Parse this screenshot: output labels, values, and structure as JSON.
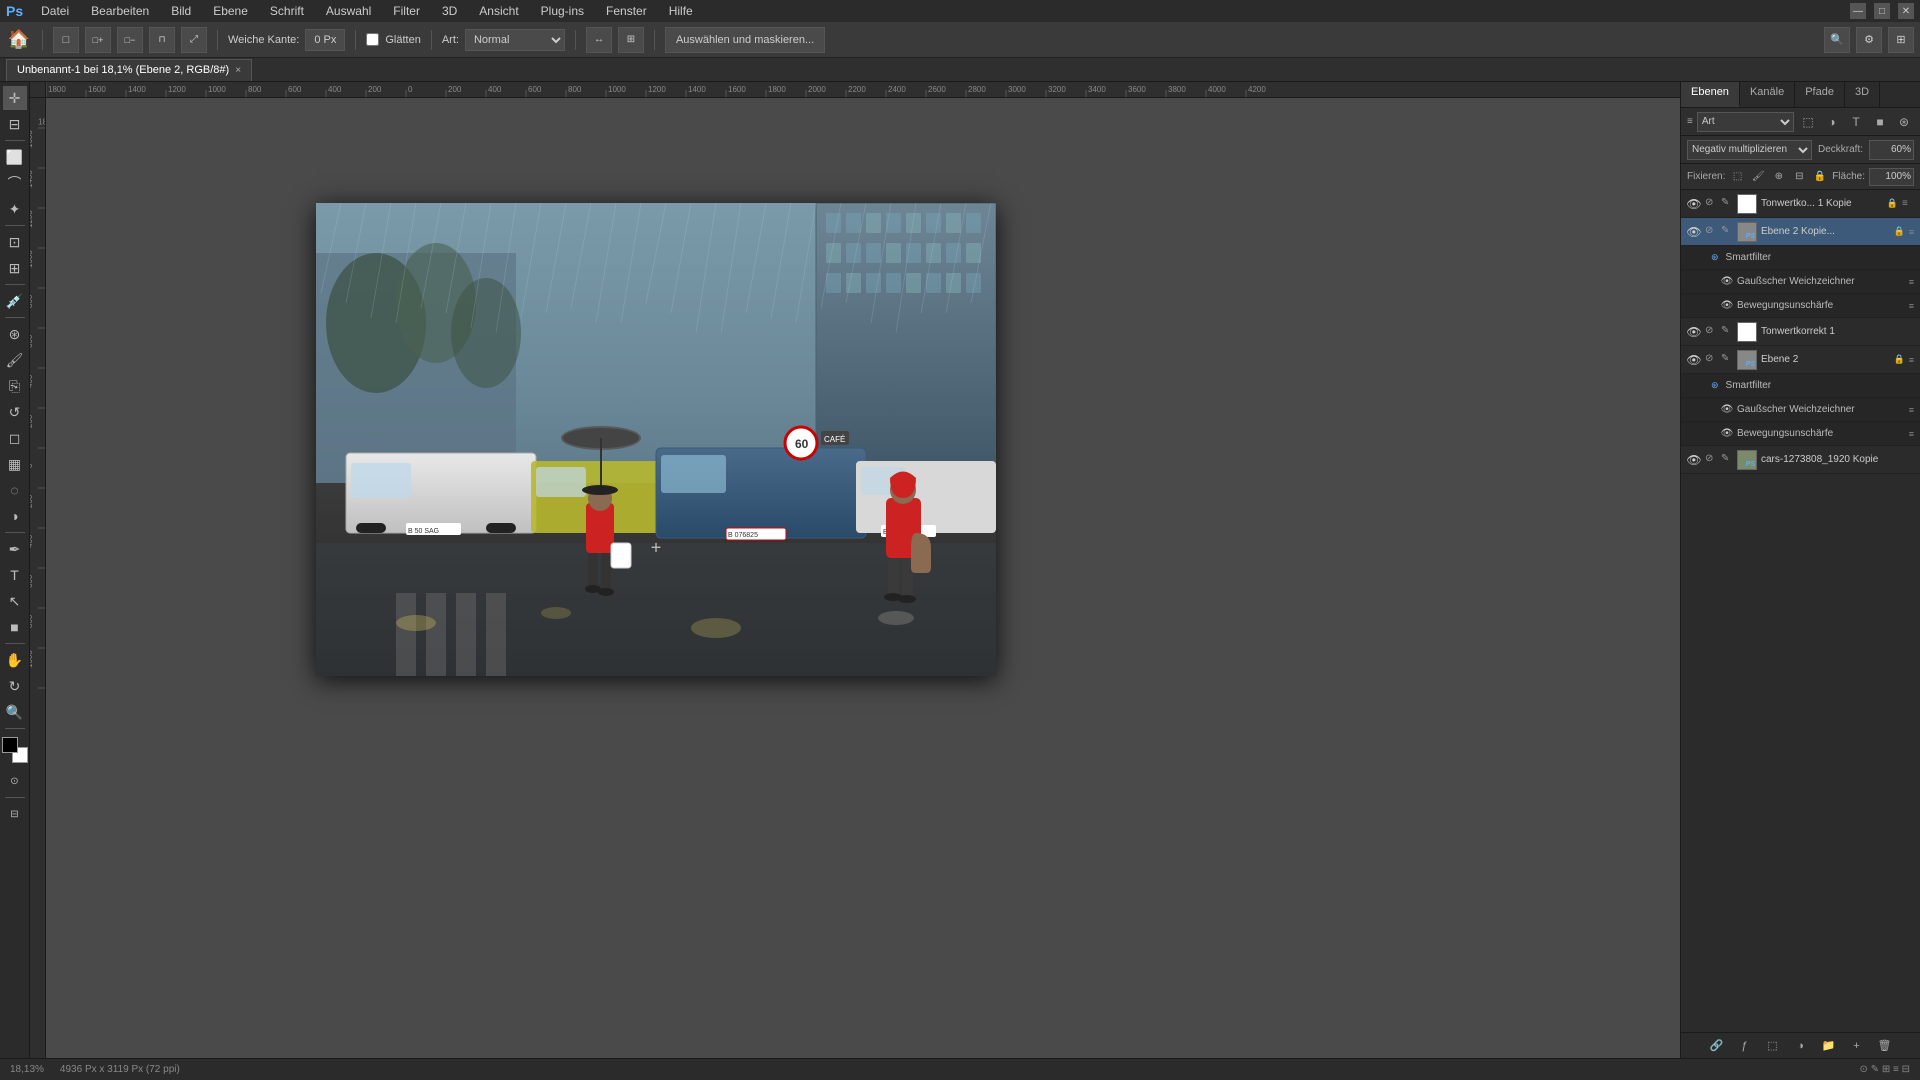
{
  "app": {
    "title": "Adobe Photoshop"
  },
  "menubar": {
    "items": [
      "Datei",
      "Bearbeiten",
      "Bild",
      "Ebene",
      "Schrift",
      "Auswahl",
      "Filter",
      "3D",
      "Ansicht",
      "Plug-ins",
      "Fenster",
      "Hilfe"
    ]
  },
  "toolbar": {
    "weiche_kante_label": "Weiche Kante:",
    "weiche_kante_value": "0 Px",
    "glatten_label": "Glätten",
    "art_label": "Art:",
    "art_value": "Normal",
    "select_mask_btn": "Auswählen und maskieren..."
  },
  "tab": {
    "title": "Unbenannt-1 bei 18,1% (Ebene 2, RGB/8#)",
    "close": "×"
  },
  "canvas": {
    "zoom_level": "18,13%",
    "image_info": "4936 Px x 3119 Px (72 ppi)"
  },
  "layers_panel": {
    "tabs": [
      "Ebenen",
      "Kanäle",
      "Pfade",
      "3D"
    ],
    "blend_mode": "Negativ multiplizieren",
    "opacity_label": "Deckkraft:",
    "opacity_value": "60%",
    "lock_label": "Fixieren:",
    "fill_label": "Fläche:",
    "fill_value": "100%",
    "layers": [
      {
        "id": "layer1",
        "name": "Tonwertko... 1 Kopie",
        "type": "adjustment",
        "visible": true,
        "has_mask": true,
        "thumb_color": "white"
      },
      {
        "id": "layer2",
        "name": "Ebene 2 Kopie...",
        "type": "smart",
        "visible": true,
        "active": true,
        "sub_layers": [
          {
            "name": "Smartfilter",
            "type": "filter-group"
          },
          {
            "name": "Gaußscher Weichzeichner",
            "type": "filter"
          },
          {
            "name": "Bewegungsunschärfe",
            "type": "filter"
          }
        ]
      },
      {
        "id": "layer3",
        "name": "Tonwertkorrekt 1",
        "type": "adjustment",
        "visible": true,
        "has_mask": true,
        "thumb_color": "white"
      },
      {
        "id": "layer4",
        "name": "Ebene 2",
        "type": "smart",
        "visible": true,
        "sub_layers": [
          {
            "name": "Smartfilter",
            "type": "filter-group"
          },
          {
            "name": "Gaußscher Weichzeichner",
            "type": "filter"
          },
          {
            "name": "Bewegungsunschärfe",
            "type": "filter"
          }
        ]
      },
      {
        "id": "layer5",
        "name": "cars-1273808_1920 Kopie",
        "type": "smart",
        "visible": true
      }
    ]
  },
  "statusbar": {
    "zoom": "18,13%",
    "dimensions": "4936 Px x 3119 Px (72 ppi)"
  },
  "tools": [
    "move",
    "select-rect",
    "lasso",
    "quick-select",
    "crop",
    "eyedropper",
    "spot-heal",
    "brush",
    "clone",
    "eraser",
    "gradient",
    "blur",
    "dodge",
    "pen",
    "type",
    "path-select",
    "shape",
    "hand",
    "zoom"
  ]
}
